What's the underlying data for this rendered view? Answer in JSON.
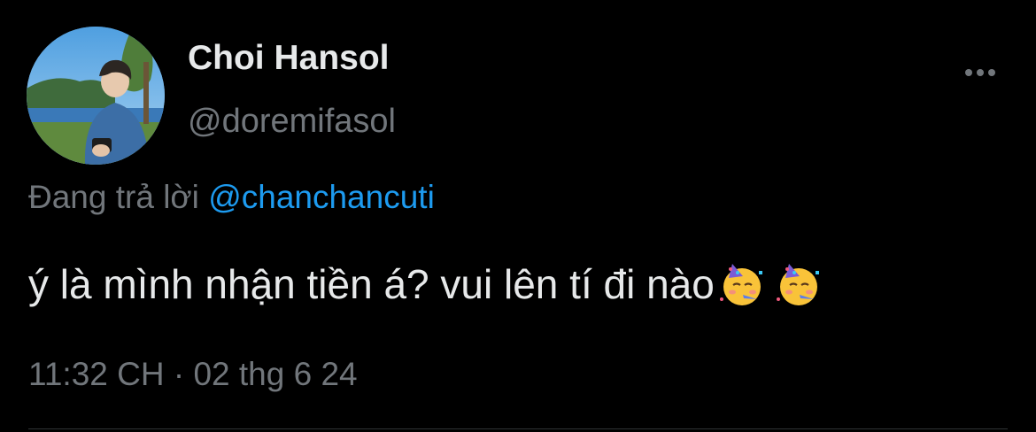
{
  "author": {
    "name": "Choi Hansol",
    "handle": "@doremifasol"
  },
  "reply": {
    "prefix": "Đang trả lời",
    "mention": "@chanchancuti"
  },
  "tweet": {
    "text": "ý là mình nhận tiền á? vui lên tí đi nào",
    "emojis": [
      "partying-face-emoji",
      "partying-face-emoji"
    ]
  },
  "meta": {
    "timestamp": "11:32 CH · 02 thg 6 24"
  },
  "icons": {
    "more": "more-horizontal-icon"
  },
  "colors": {
    "background": "#000000",
    "primary_text": "#e7e9ea",
    "secondary_text": "#71767b",
    "accent": "#1d9bf0",
    "divider": "#2f3336"
  }
}
